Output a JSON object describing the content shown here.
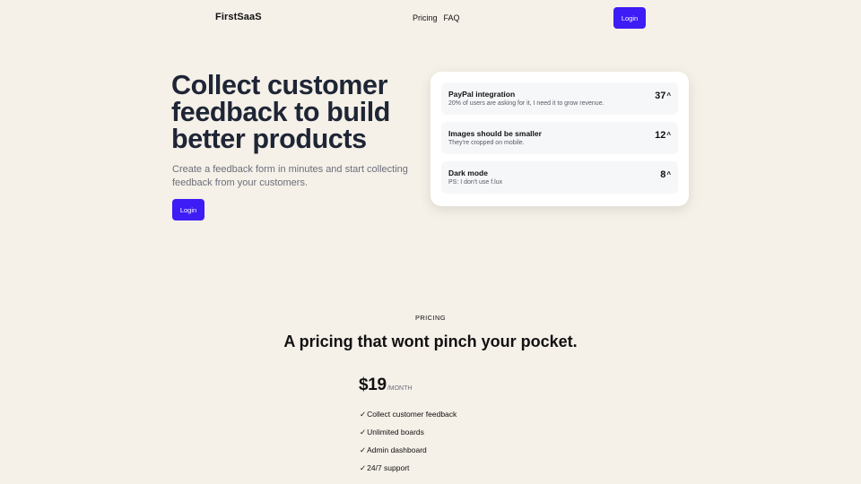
{
  "header": {
    "brand": "FirstSaaS",
    "nav": [
      "Pricing",
      "FAQ"
    ],
    "login_label": "Login"
  },
  "hero": {
    "title": "Collect customer feedback to build better products",
    "subtitle": "Create a feedback form in minutes and start collecting feedback from your customers.",
    "login_label": "Login"
  },
  "feedback": [
    {
      "title": "PayPal integration",
      "description": "20% of users are asking for it, I need it to grow revenue.",
      "votes": "37"
    },
    {
      "title": "Images should be smaller",
      "description": "They're cropped on mobile.",
      "votes": "12"
    },
    {
      "title": "Dark mode",
      "description": "PS: I don't use f.lux",
      "votes": "8"
    }
  ],
  "pricing": {
    "label": "PRICING",
    "title": "A pricing that wont pinch your pocket.",
    "amount": "$19",
    "period": "/MONTH",
    "check_glyph": "✓",
    "features": [
      "Collect customer feedback",
      "Unlimited boards",
      "Admin dashboard",
      "24/7 support"
    ]
  },
  "colors": {
    "background": "#f5f0e8",
    "accent": "#3d1cf5",
    "heading": "#1e2535"
  },
  "icons": {
    "vote": "chevron-up-icon",
    "feature": "check-icon"
  }
}
